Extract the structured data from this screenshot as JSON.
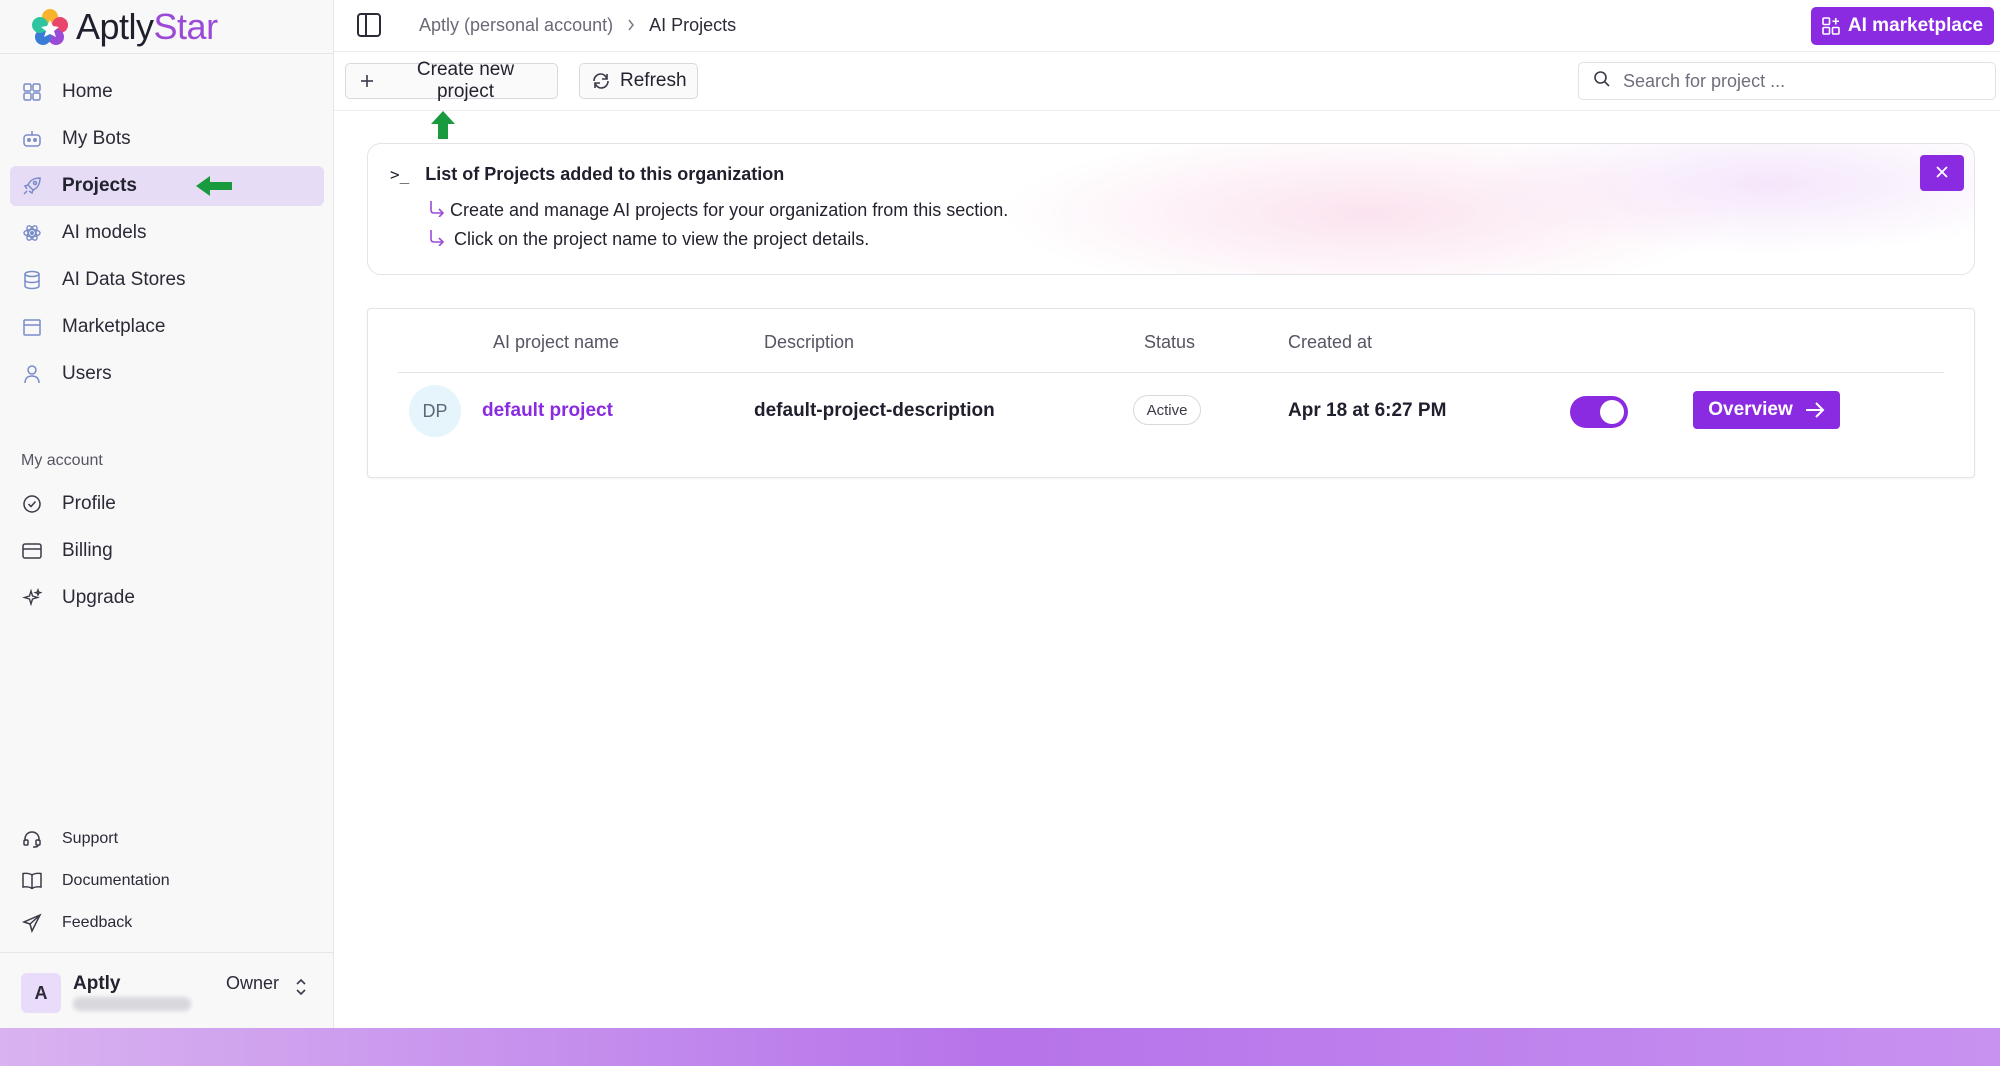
{
  "brand": {
    "name_main": "Aptly",
    "name_accent": "Star"
  },
  "colors": {
    "accent": "#8a2be2",
    "active_nav_bg": "#e6dcf6",
    "guide_arrow": "#1a9a3e"
  },
  "sidebar": {
    "items": [
      {
        "label": "Home",
        "icon": "home-grid-icon"
      },
      {
        "label": "My Bots",
        "icon": "bot-icon"
      },
      {
        "label": "Projects",
        "icon": "rocket-icon",
        "active": true
      },
      {
        "label": "AI models",
        "icon": "atom-icon"
      },
      {
        "label": "AI Data Stores",
        "icon": "database-icon"
      },
      {
        "label": "Marketplace",
        "icon": "store-icon"
      },
      {
        "label": "Users",
        "icon": "user-icon"
      }
    ],
    "section_label": "My account",
    "account_items": [
      {
        "label": "Profile",
        "icon": "check-circle-icon"
      },
      {
        "label": "Billing",
        "icon": "credit-card-icon"
      },
      {
        "label": "Upgrade",
        "icon": "sparkle-icon"
      }
    ],
    "bottom_links": [
      {
        "label": "Support",
        "icon": "headset-icon"
      },
      {
        "label": "Documentation",
        "icon": "book-icon"
      },
      {
        "label": "Feedback",
        "icon": "send-icon"
      }
    ],
    "user": {
      "initial": "A",
      "name": "Aptly",
      "role": "Owner"
    }
  },
  "header": {
    "breadcrumb": [
      "Aptly (personal account)",
      "AI Projects"
    ],
    "marketplace_button": "AI marketplace"
  },
  "toolbar": {
    "create_label": "Create new project",
    "refresh_label": "Refresh",
    "search_placeholder": "Search for project ..."
  },
  "info": {
    "title": "List of Projects added to this organization",
    "lines": [
      "Create and manage AI projects for your organization from this section.",
      "Click on the project name to view the project details."
    ]
  },
  "table": {
    "columns": [
      "AI project name",
      "Description",
      "Status",
      "Created at"
    ],
    "rows": [
      {
        "initials": "DP",
        "name": "default project",
        "description": "default-project-description",
        "status": "Active",
        "created": "Apr 18 at 6:27 PM",
        "enabled": true,
        "action": "Overview"
      }
    ]
  }
}
